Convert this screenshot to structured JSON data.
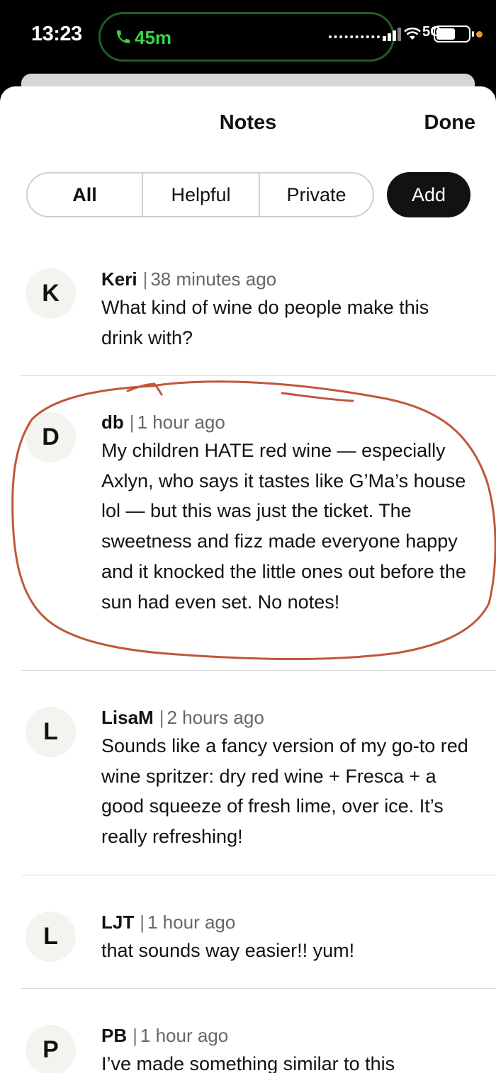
{
  "status_bar": {
    "time": "13:23",
    "call_duration": "45m",
    "network": "5G",
    "colors": {
      "call_green": "#3fd24a",
      "privacy_dot": "#f0962f"
    }
  },
  "header": {
    "title": "Notes",
    "done_label": "Done"
  },
  "tabs": [
    {
      "label": "All",
      "selected": true
    },
    {
      "label": "Helpful",
      "selected": false
    },
    {
      "label": "Private",
      "selected": false
    }
  ],
  "add_label": "Add",
  "comments": [
    {
      "initial": "K",
      "author": "Keri",
      "separator": "|",
      "time": "38 minutes ago",
      "text": "What kind of wine do people make this drink with?"
    },
    {
      "initial": "D",
      "author": "db",
      "separator": "|",
      "time": "1 hour ago",
      "text": "My children HATE red wine — especially Axlyn, who says it tastes like G’Ma’s house lol — but this was just the ticket. The sweetness and fizz made everyone happy and it knocked the little ones out before the sun had even set. No notes!"
    },
    {
      "initial": "L",
      "author": "LisaM",
      "separator": "|",
      "time": "2 hours ago",
      "text": "Sounds like a fancy version of my go-to red wine spritzer: dry red wine + Fresca + a good squeeze of fresh lime, over ice. It’s really refreshing!"
    },
    {
      "initial": "L",
      "author": "LJT",
      "separator": "|",
      "time": "1 hour ago",
      "text": "that sounds way easier!! yum!"
    },
    {
      "initial": "P",
      "author": "PB",
      "separator": "|",
      "time": "1 hour ago",
      "text": "I’ve made something similar to this"
    }
  ],
  "annotation_color": "#c0573a"
}
